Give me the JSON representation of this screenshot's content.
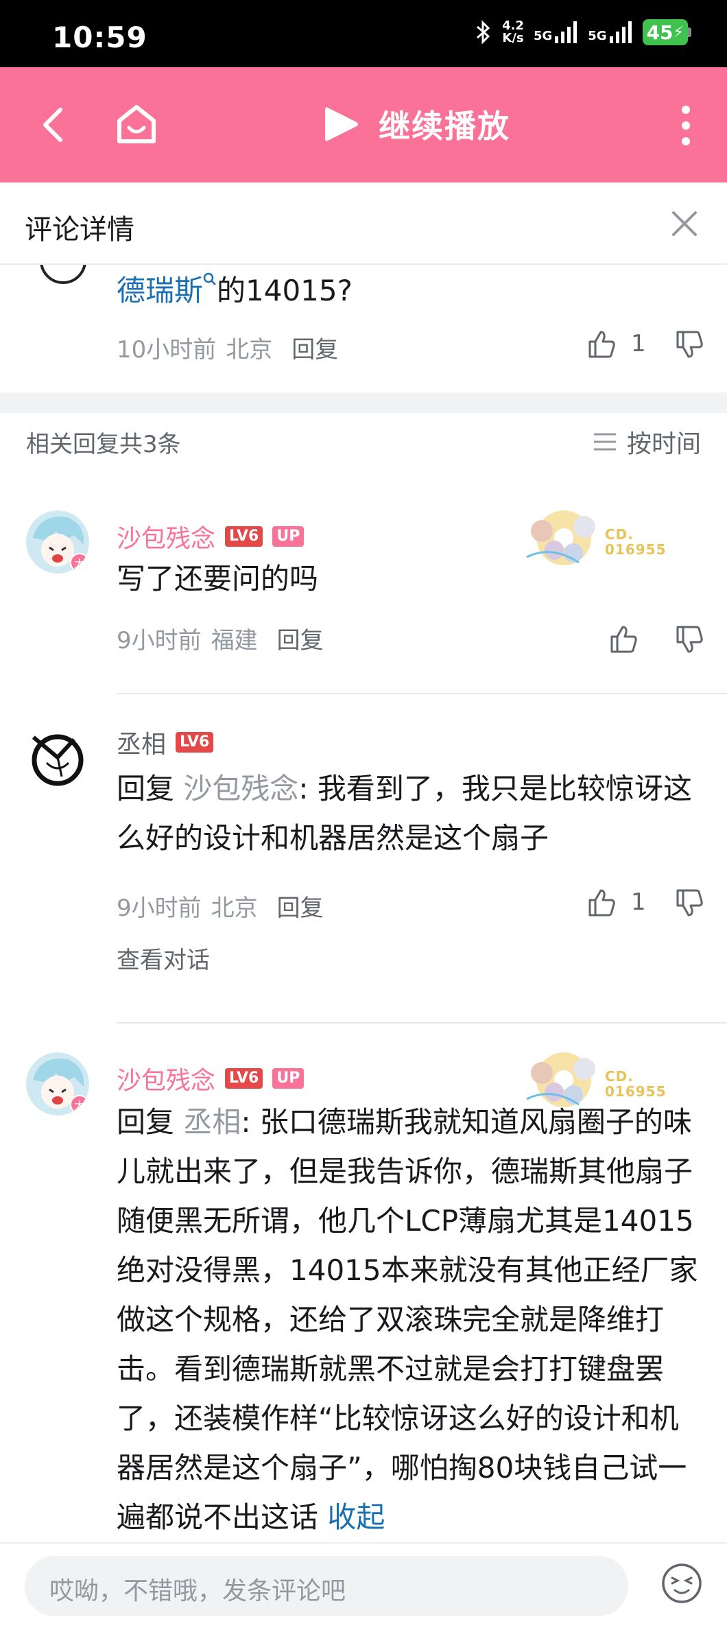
{
  "status_bar": {
    "time": "10:59",
    "net_speed_top": "4.2",
    "net_speed_bottom": "K/s",
    "signal1": "5G",
    "signal2": "5G",
    "battery": "45"
  },
  "top_bar": {
    "play_title": "继续播放",
    "color": "#fb7299"
  },
  "header": {
    "title": "评论详情"
  },
  "parent_comment_tail": {
    "link_text": "德瑞斯",
    "text_rest": "的14015?",
    "time": "10小时前",
    "location": "北京",
    "reply_label": "回复",
    "like_count": "1"
  },
  "replies_section": {
    "count_label": "相关回复共3条",
    "sort_label": "按时间"
  },
  "comments": [
    {
      "user": "沙包残念",
      "level": "LV6",
      "up_badge": "UP",
      "avatar_badge": "大",
      "fan_badge_number": "CD.\n016955",
      "text": "写了还要问的吗",
      "time": "9小时前",
      "location": "福建",
      "reply_label": "回复",
      "like_count": ""
    },
    {
      "user": "丞相",
      "level": "LV6",
      "reply_prefix": "回复",
      "reply_to": "沙包残念",
      "text": ": 我看到了，我只是比较惊讶这么好的设计和机器居然是这个扇子",
      "time": "9小时前",
      "location": "北京",
      "reply_label": "回复",
      "like_count": "1",
      "view_convo": "查看对话"
    },
    {
      "user": "沙包残念",
      "level": "LV6",
      "up_badge": "UP",
      "avatar_badge": "大",
      "fan_badge_number": "CD.\n016955",
      "reply_prefix": "回复",
      "reply_to": "丞相",
      "text": ": 张口德瑞斯我就知道风扇圈子的味儿就出来了，但是我告诉你，德瑞斯其他扇子随便黑无所谓，他几个LCP薄扇尤其是14015绝对没得黑，14015本来就没有其他正经厂家做这个规格，还给了双滚珠完全就是降维打击。看到德瑞斯就黑不过就是会打打键盘罢了，还装模作样“比较惊讶这么好的设计和机器居然是这个扇子”，哪怕掏80块钱自己试一遍都说不出这话",
      "collapse": "收起"
    }
  ],
  "bottom_bar": {
    "placeholder": "哎呦，不错哦，发条评论吧"
  }
}
